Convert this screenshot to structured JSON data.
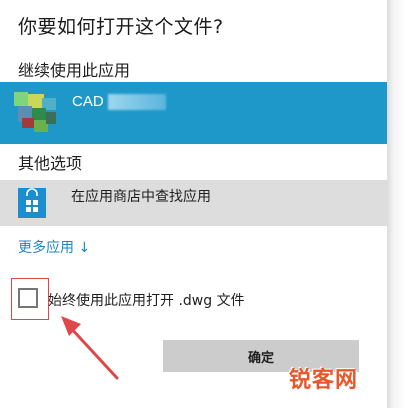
{
  "dialog": {
    "title": "你要如何打开这个文件?",
    "continue_section_label": "继续使用此应用",
    "current_app": {
      "name": "CAD",
      "icon": "cad-app-icon"
    },
    "other_options_label": "其他选项",
    "store_option": {
      "label": "在应用商店中查找应用",
      "icon": "store-bag-icon"
    },
    "more_apps_link": "更多应用 ↓",
    "always_use": {
      "label": "始终使用此应用打开 .dwg 文件",
      "checked": false
    },
    "ok_button": "确定"
  },
  "watermark": "锐客网",
  "colors": {
    "accent": "#1e98c8",
    "link": "#1e86c8",
    "annotation": "#e0474a",
    "watermark": "#e8572a"
  }
}
